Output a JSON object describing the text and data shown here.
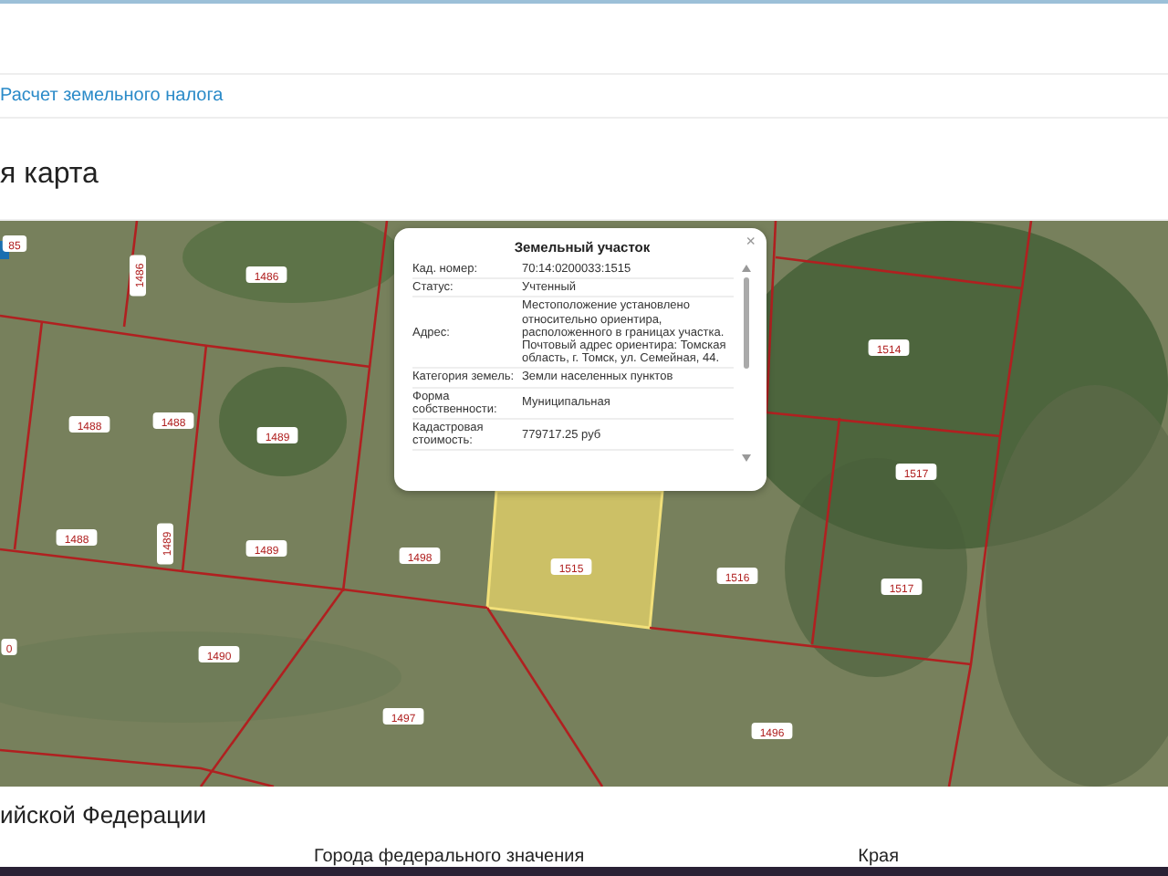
{
  "breadcrumb": {
    "link": "Расчет земельного налога"
  },
  "heading": "я карта",
  "map": {
    "parcels": [
      "85",
      "1486",
      "1486",
      "1488",
      "1488",
      "1489",
      "1488",
      "1489",
      "1489",
      "1498",
      "1515",
      "1516",
      "1514",
      "1517",
      "1517",
      "0",
      "1490",
      "1497",
      "1496"
    ],
    "popup": {
      "title": "Земельный участок",
      "close": "×",
      "rows": [
        {
          "label": "Кад. номер:",
          "value": "70:14:0200033:1515"
        },
        {
          "label": "Статус:",
          "value": "Учтенный"
        },
        {
          "label": "Адрес:",
          "value": "Местоположение установлено относительно ориентира, расположенного в границах участка. Почтовый адрес ориентира: Томская область, г. Томск, ул. Семейная, 44."
        },
        {
          "label": "Категория земель:",
          "value": "Земли населенных пунктов"
        },
        {
          "label": "Форма собственности:",
          "value": "Муниципальная"
        },
        {
          "label": "Кадастровая стоимость:",
          "value": "779717.25 руб"
        }
      ]
    }
  },
  "section": {
    "heading": "ийской Федерации",
    "columns": [
      "Города федерального значения",
      "Края"
    ]
  }
}
